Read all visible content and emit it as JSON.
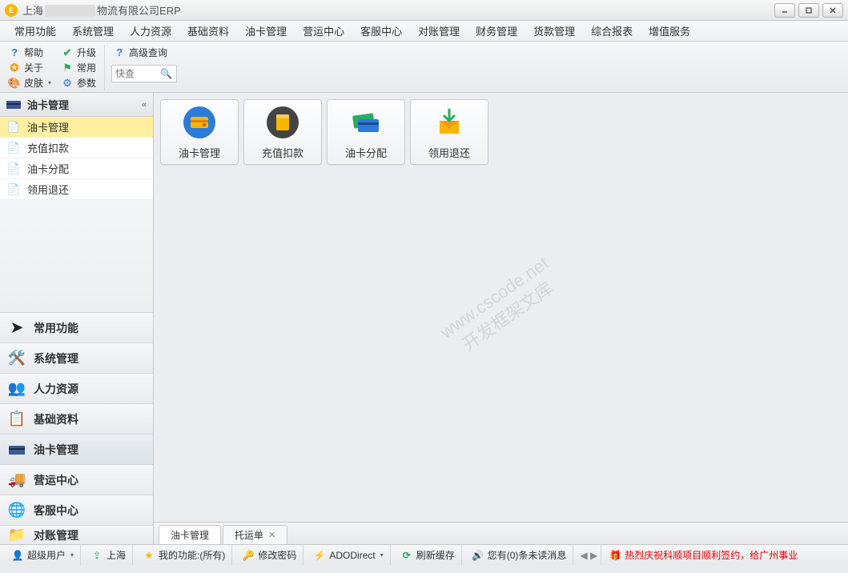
{
  "window": {
    "title_prefix": "上海",
    "title_suffix": "物流有限公司ERP"
  },
  "menus": [
    "常用功能",
    "系统管理",
    "人力资源",
    "基础资料",
    "油卡管理",
    "营运中心",
    "客服中心",
    "对账管理",
    "财务管理",
    "货款管理",
    "综合报表",
    "增值服务"
  ],
  "toolbar": {
    "help": "帮助",
    "about": "关于",
    "skin": "皮肤",
    "upgrade": "升级",
    "common": "常用",
    "params": "参数",
    "advanced_search": "高级查询",
    "quick_search_placeholder": "快查"
  },
  "sidebar": {
    "header": "油卡管理",
    "items": [
      {
        "label": "油卡管理",
        "active": true
      },
      {
        "label": "充值扣款",
        "active": false
      },
      {
        "label": "油卡分配",
        "active": false
      },
      {
        "label": "领用退还",
        "active": false
      }
    ],
    "categories": [
      {
        "label": "常用功能"
      },
      {
        "label": "系统管理"
      },
      {
        "label": "人力资源"
      },
      {
        "label": "基础资料"
      },
      {
        "label": "油卡管理",
        "active": true
      },
      {
        "label": "营运中心"
      },
      {
        "label": "客服中心"
      },
      {
        "label": "对账管理"
      }
    ]
  },
  "tiles": [
    {
      "label": "油卡管理"
    },
    {
      "label": "充值扣款"
    },
    {
      "label": "油卡分配"
    },
    {
      "label": "领用退还"
    }
  ],
  "watermark": {
    "line1": "www.cscode.net",
    "line2": "开发框架文库"
  },
  "tabs": [
    {
      "label": "油卡管理",
      "active": true,
      "closable": false
    },
    {
      "label": "托运单",
      "active": false,
      "closable": true
    }
  ],
  "status": {
    "user_label": "超级用户",
    "branch": "上海",
    "my_func": "我的功能:(所有)",
    "change_pwd": "修改密码",
    "ado": "ADODirect",
    "refresh": "刷新缓存",
    "unread": "您有(0)条未读消息",
    "marquee": "热烈庆祝科顺项目顺利签约，给广州事业"
  },
  "colors": {
    "yellow": "#f7b500",
    "green": "#27ae60",
    "blue": "#2d7bd8",
    "orange": "#f39c12",
    "teal": "#1abc9c",
    "purple": "#8e44ad",
    "red": "#d94b3b"
  }
}
